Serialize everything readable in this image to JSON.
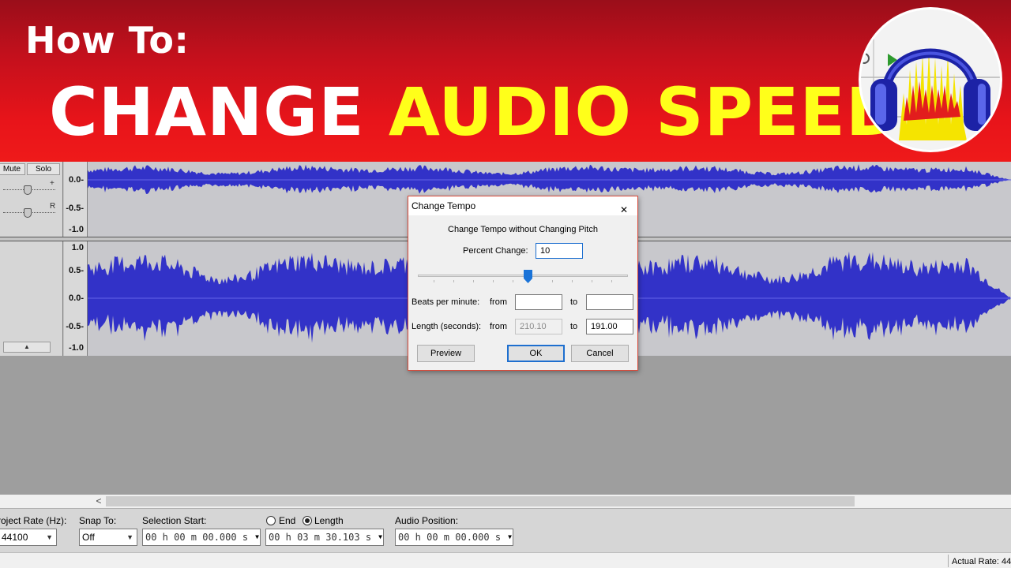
{
  "banner": {
    "how_to": "How To:",
    "title_white": "CHANGE",
    "title_yellow": "AUDIO SPEED",
    "logo_icon": "audacity-headphones-logo"
  },
  "track": {
    "mute": "Mute",
    "solo": "Solo",
    "gain_plus": "+",
    "pan_right": "R",
    "collapse_icon": "triangle-up-icon",
    "ruler_top": [
      "0.0-",
      "-0.5-",
      "-1.0"
    ],
    "ruler_bottom": [
      "1.0",
      "0.5-",
      "0.0-",
      "-0.5-",
      "-1.0"
    ],
    "waveform_color": "#3232c8"
  },
  "dialog": {
    "title": "Change Tempo",
    "close_icon": "close-icon",
    "subtitle": "Change Tempo without Changing Pitch",
    "percent_label": "Percent Change:",
    "percent_value": "10",
    "bpm_label": "Beats per minute:",
    "from": "from",
    "to": "to",
    "bpm_from": "",
    "bpm_to": "",
    "length_label": "Length (seconds):",
    "length_from": "210.10",
    "length_to": "191.00",
    "preview": "Preview",
    "ok": "OK",
    "cancel": "Cancel",
    "accent": "#1a73d8"
  },
  "selection_bar": {
    "project_rate_label": "roject Rate (Hz):",
    "project_rate_value": "44100",
    "snap_label": "Snap To:",
    "snap_value": "Off",
    "selection_start_label": "Selection Start:",
    "selection_start_value": "00 h 00 m 00.000 s",
    "end_label": "End",
    "length_label": "Length",
    "length_value": "00 h 03 m 30.103 s",
    "audio_position_label": "Audio Position:",
    "audio_position_value": "00 h 00 m 00.000 s"
  },
  "scroll": {
    "left_arrow": "<"
  },
  "status": {
    "actual_rate": "Actual Rate: 44"
  }
}
